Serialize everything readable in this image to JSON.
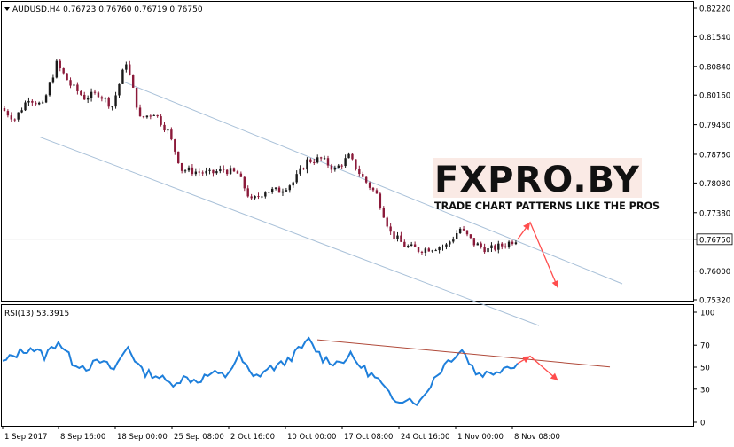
{
  "header": {
    "symbol_line": "AUDUSD,H4  0.76723 0.76760 0.76719 0.76750",
    "rsi_label": "RSI(13) 53.3915"
  },
  "watermark": {
    "brand": "FXPRO.BY",
    "tagline": "TRADE CHART PATTERNS LIKE THE PROS"
  },
  "colors": {
    "background": "#ffffff",
    "frame": "#000000",
    "candle_up": "#1a1a1a",
    "candle_down": "#8b1a3a",
    "channel": "#a8c0d8",
    "rsi_line": "#1e7fdb",
    "rsi_trend": "#b04a3a",
    "arrow": "#ff4d4d",
    "brand_text": "#111111",
    "brand_bg": "#f5d9cf",
    "brand_dot": "#e03a2a"
  },
  "price_axis": {
    "ticks": [
      "0.82220",
      "0.81540",
      "0.80840",
      "0.80160",
      "0.79460",
      "0.78760",
      "0.78080",
      "0.77380",
      "0.76750",
      "0.76000",
      "0.75320"
    ],
    "current": "0.76750"
  },
  "rsi_axis": {
    "ticks": [
      "100",
      "70",
      "50",
      "30",
      "0"
    ]
  },
  "time_axis": {
    "ticks": [
      "1 Sep 2017",
      "8 Sep 16:00",
      "18 Sep 00:00",
      "25 Sep 08:00",
      "2 Oct 16:00",
      "10 Oct 00:00",
      "17 Oct 08:00",
      "24 Oct 16:00",
      "1 Nov 00:00",
      "8 Nov 08:00"
    ]
  },
  "chart_data": [
    {
      "type": "candlestick",
      "title": "AUDUSD,H4",
      "ylim": [
        0.7532,
        0.8222
      ],
      "last_bar": {
        "open": 0.76723,
        "high": 0.7676,
        "low": 0.76719,
        "close": 0.7675
      },
      "close_path": [
        [
          "1 Sep 2017",
          0.7985
        ],
        [
          "4 Sep",
          0.796
        ],
        [
          "6 Sep",
          0.801
        ],
        [
          "7 Sep",
          0.799
        ],
        [
          "8 Sep 16:00",
          0.809
        ],
        [
          "11 Sep",
          0.804
        ],
        [
          "13 Sep",
          0.801
        ],
        [
          "15 Sep",
          0.802
        ],
        [
          "18 Sep 00:00",
          0.799
        ],
        [
          "20 Sep",
          0.8095
        ],
        [
          "21 Sep",
          0.796
        ],
        [
          "22 Sep",
          0.7975
        ],
        [
          "25 Sep 08:00",
          0.793
        ],
        [
          "27 Sep",
          0.784
        ],
        [
          "28 Sep",
          0.7835
        ],
        [
          "29 Sep",
          0.783
        ],
        [
          "2 Oct 16:00",
          0.784
        ],
        [
          "4 Oct",
          0.783
        ],
        [
          "5 Oct",
          0.7765
        ],
        [
          "6 Oct",
          0.779
        ],
        [
          "10 Oct 00:00",
          0.779
        ],
        [
          "11 Oct",
          0.781
        ],
        [
          "12 Oct",
          0.786
        ],
        [
          "13 Oct",
          0.7865
        ],
        [
          "17 Oct 08:00",
          0.784
        ],
        [
          "19 Oct",
          0.787
        ],
        [
          "20 Oct",
          0.782
        ],
        [
          "23 Oct",
          0.778
        ],
        [
          "24 Oct 16:00",
          0.769
        ],
        [
          "26 Oct",
          0.766
        ],
        [
          "27 Oct",
          0.765
        ],
        [
          "30 Oct",
          0.7655
        ],
        [
          "1 Nov 00:00",
          0.766
        ],
        [
          "2 Nov",
          0.77
        ],
        [
          "3 Nov",
          0.7665
        ],
        [
          "6 Nov",
          0.765
        ],
        [
          "7 Nov",
          0.766
        ],
        [
          "8 Nov 08:00",
          0.7675
        ]
      ],
      "channel": {
        "upper": [
          [
            "8 Sep 16:00",
            0.811
          ],
          [
            "8 Nov 08:00",
            0.767
          ]
        ],
        "lower": [
          [
            "1 Sep 2017",
            0.795
          ],
          [
            "8 Nov 08:00",
            0.749
          ]
        ]
      },
      "projection": [
        [
          "8 Nov 08:00",
          0.7675
        ],
        [
          "9 Nov",
          0.7715
        ],
        [
          "10 Nov",
          0.756
        ]
      ]
    },
    {
      "type": "line",
      "title": "RSI(13)",
      "last_value": 53.3915,
      "ylim": [
        0,
        100
      ],
      "levels": [
        70,
        50,
        30
      ],
      "path": [
        [
          "1 Sep 2017",
          54
        ],
        [
          "4 Sep",
          62
        ],
        [
          "6 Sep",
          68
        ],
        [
          "7 Sep",
          60
        ],
        [
          "8 Sep 16:00",
          74
        ],
        [
          "11 Sep",
          55
        ],
        [
          "13 Sep",
          50
        ],
        [
          "15 Sep",
          55
        ],
        [
          "18 Sep 00:00",
          48
        ],
        [
          "20 Sep",
          69
        ],
        [
          "21 Sep",
          46
        ],
        [
          "22 Sep",
          43
        ],
        [
          "25 Sep 08:00",
          35
        ],
        [
          "27 Sep",
          40
        ],
        [
          "28 Sep",
          38
        ],
        [
          "29 Sep",
          44
        ],
        [
          "2 Oct 16:00",
          42
        ],
        [
          "4 Oct",
          60
        ],
        [
          "5 Oct",
          40
        ],
        [
          "6 Oct",
          48
        ],
        [
          "10 Oct 00:00",
          52
        ],
        [
          "11 Oct",
          62
        ],
        [
          "12 Oct",
          74
        ],
        [
          "13 Oct",
          58
        ],
        [
          "17 Oct 08:00",
          54
        ],
        [
          "19 Oct",
          60
        ],
        [
          "20 Oct",
          48
        ],
        [
          "23 Oct",
          38
        ],
        [
          "24 Oct 16:00",
          20
        ],
        [
          "26 Oct",
          22
        ],
        [
          "27 Oct",
          18
        ],
        [
          "30 Oct",
          40
        ],
        [
          "1 Nov 00:00",
          56
        ],
        [
          "2 Nov",
          66
        ],
        [
          "3 Nov",
          45
        ],
        [
          "6 Nov",
          44
        ],
        [
          "7 Nov",
          50
        ],
        [
          "8 Nov 08:00",
          53.3915
        ]
      ],
      "trendline": [
        [
          "10 Oct 00:00",
          78
        ],
        [
          "8 Nov 08:00",
          58
        ]
      ],
      "projection": [
        [
          "8 Nov 08:00",
          53.3915
        ],
        [
          "9 Nov",
          60
        ],
        [
          "10 Nov",
          38
        ]
      ]
    }
  ]
}
